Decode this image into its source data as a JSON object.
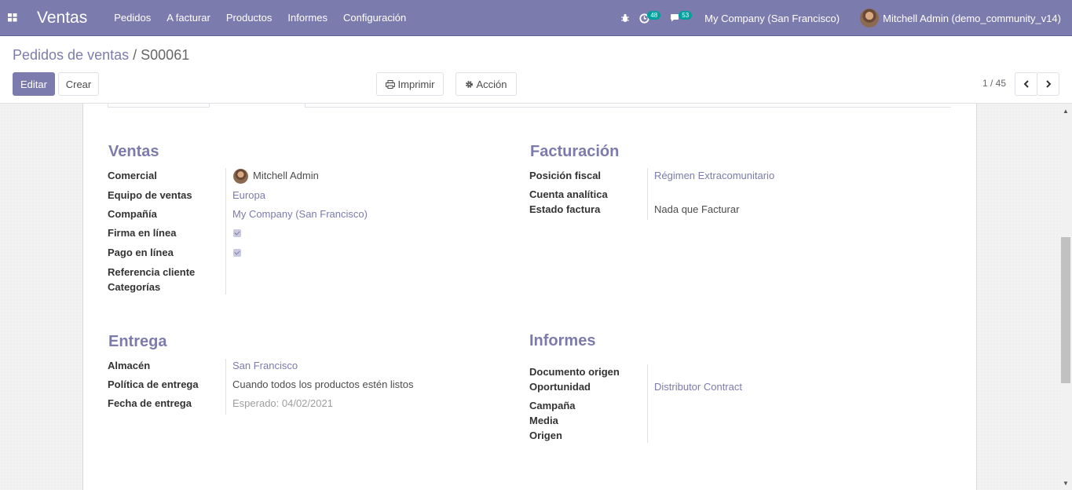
{
  "navbar": {
    "app_name": "Ventas",
    "menu": [
      "Pedidos",
      "A facturar",
      "Productos",
      "Informes",
      "Configuración"
    ],
    "activity_count": "48",
    "messages_count": "53",
    "company": "My Company (San Francisco)",
    "user": "Mitchell Admin (demo_community_v14)"
  },
  "control_panel": {
    "breadcrumb_parent": "Pedidos de ventas",
    "breadcrumb_separator": "/",
    "breadcrumb_current": "S00061",
    "edit_label": "Editar",
    "create_label": "Crear",
    "print_label": "Imprimir",
    "action_label": "Acción",
    "pager": "1 / 45"
  },
  "ventas": {
    "title": "Ventas",
    "comercial_label": "Comercial",
    "comercial_value": "Mitchell Admin",
    "equipo_label": "Equipo de ventas",
    "equipo_value": "Europa",
    "compania_label": "Compañía",
    "compania_value": "My Company (San Francisco)",
    "firma_label": "Firma en línea",
    "firma_checked": true,
    "pago_label": "Pago en línea",
    "pago_checked": true,
    "referencia_label": "Referencia cliente",
    "categorias_label": "Categorías"
  },
  "facturacion": {
    "title": "Facturación",
    "posicion_label": "Posición fiscal",
    "posicion_value": "Régimen Extracomunitario",
    "cuenta_label": "Cuenta analítica",
    "estado_label": "Estado factura",
    "estado_value": "Nada que Facturar"
  },
  "entrega": {
    "title": "Entrega",
    "almacen_label": "Almacén",
    "almacen_value": "San Francisco",
    "politica_label": "Política de entrega",
    "politica_value": "Cuando todos los productos estén listos",
    "fecha_label": "Fecha de entrega",
    "fecha_value": "Esperado: 04/02/2021"
  },
  "informes": {
    "title": "Informes",
    "documento_label": "Documento origen",
    "oportunidad_label": "Oportunidad",
    "oportunidad_value": "Distributor Contract",
    "campana_label": "Campaña",
    "media_label": "Media",
    "origen_label": "Origen"
  },
  "colors": {
    "brand": "#7c7bad",
    "badge": "#00a09d"
  }
}
